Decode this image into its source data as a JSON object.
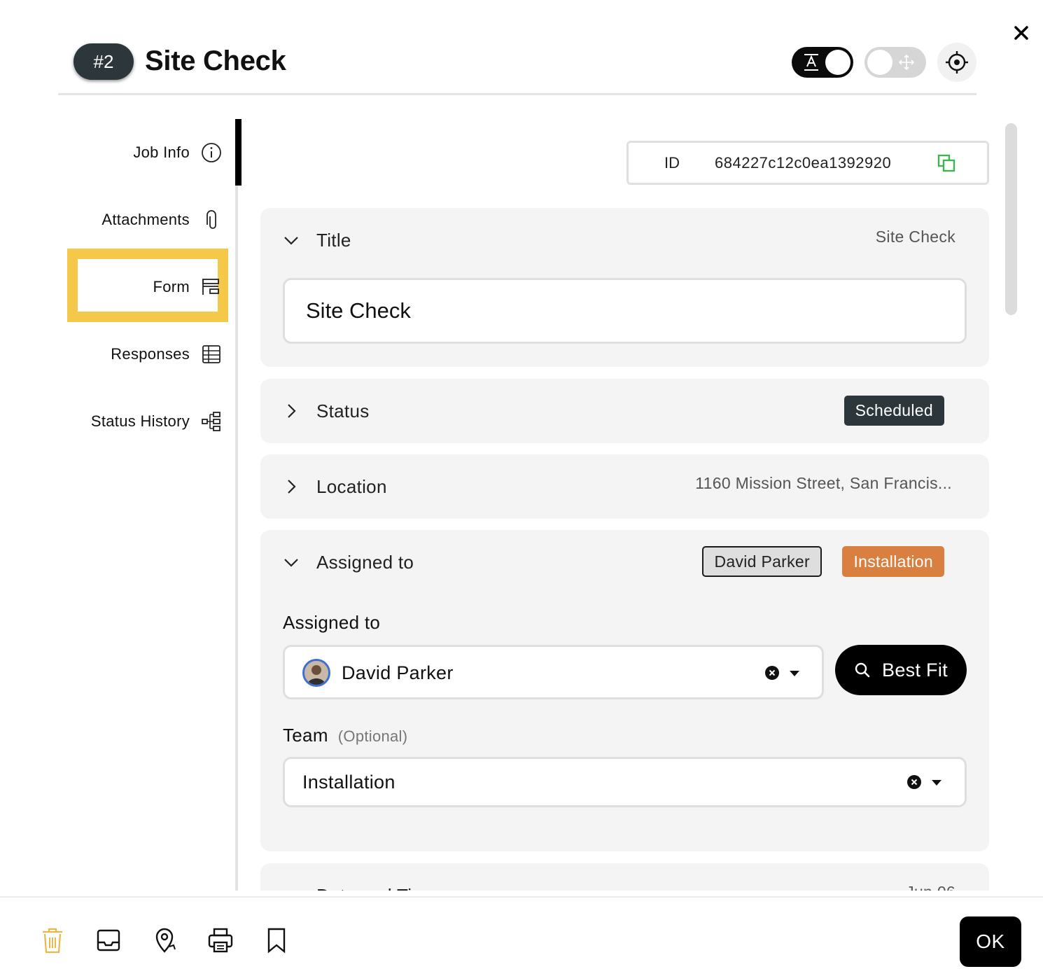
{
  "header": {
    "job_number": "#2",
    "title": "Site Check"
  },
  "toolbar": {
    "text_toggle_on": true,
    "move_toggle_on": false,
    "icons": [
      "text-mode-icon",
      "move-arrows-icon",
      "crosshair-icon",
      "close-icon"
    ]
  },
  "sidebar": {
    "items": [
      {
        "label": "Job Info",
        "icon": "info-icon",
        "active": true
      },
      {
        "label": "Attachments",
        "icon": "paperclip-icon"
      },
      {
        "label": "Form",
        "icon": "form-icon",
        "highlighted": true
      },
      {
        "label": "Responses",
        "icon": "table-icon"
      },
      {
        "label": "Status History",
        "icon": "hierarchy-icon"
      }
    ]
  },
  "job_id": {
    "label": "ID",
    "value": "684227c12c0ea1392920"
  },
  "sections": {
    "title": {
      "label": "Title",
      "summary": "Site Check",
      "input_value": "Site Check",
      "expanded": true
    },
    "status": {
      "label": "Status",
      "badge": "Scheduled",
      "expanded": false
    },
    "location": {
      "label": "Location",
      "summary": "1160 Mission Street, San Francis...",
      "expanded": false
    },
    "assigned": {
      "label": "Assigned to",
      "badge_person": "David Parker",
      "badge_team": "Installation",
      "field_label": "Assigned to",
      "assignee_value": "David Parker",
      "best_fit_label": "Best Fit",
      "team_label": "Team",
      "team_hint": "(Optional)",
      "team_value": "Installation",
      "expanded": true
    },
    "datetime": {
      "label": "Date and Ti",
      "summary": "Jun 06"
    }
  },
  "footer": {
    "icons": [
      "trash-icon",
      "inbox-icon",
      "map-pin-icon",
      "printer-icon",
      "bookmark-icon"
    ],
    "ok_label": "OK"
  },
  "colors": {
    "badge_dark": "#2d363b",
    "highlight_yellow": "#f6c84a",
    "team_orange": "#d98040",
    "copy_green": "#3fb34f",
    "trash_yellow": "#e7b84a"
  }
}
